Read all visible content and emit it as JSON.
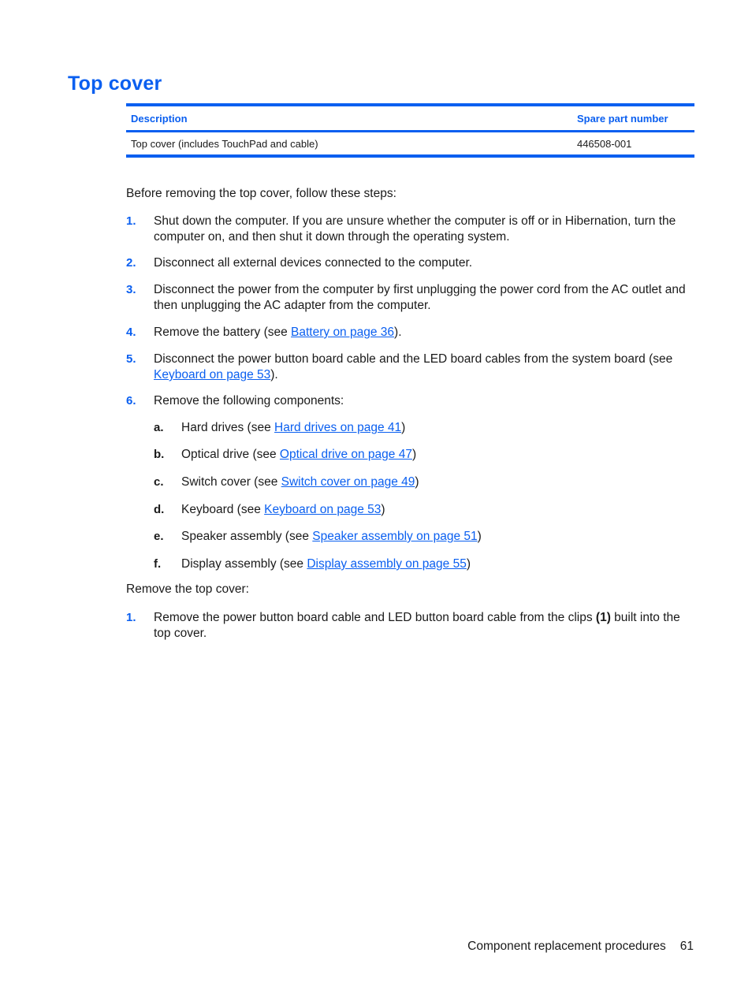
{
  "title": "Top cover",
  "table": {
    "headers": [
      "Description",
      "Spare part number"
    ],
    "rows": [
      {
        "description": "Top cover (includes TouchPad and cable)",
        "part_number": "446508-001"
      }
    ]
  },
  "intro": "Before removing the top cover, follow these steps:",
  "prep_steps": [
    {
      "num": "1.",
      "text": "Shut down the computer. If you are unsure whether the computer is off or in Hibernation, turn the computer on, and then shut it down through the operating system."
    },
    {
      "num": "2.",
      "text": "Disconnect all external devices connected to the computer."
    },
    {
      "num": "3.",
      "text": "Disconnect the power from the computer by first unplugging the power cord from the AC outlet and then unplugging the AC adapter from the computer."
    },
    {
      "num": "4.",
      "before": "Remove the battery (see ",
      "link": "Battery on page 36",
      "after": ")."
    },
    {
      "num": "5.",
      "before": "Disconnect the power button board cable and the LED board cables from the system board (see ",
      "link": "Keyboard on page 53",
      "after": ")."
    },
    {
      "num": "6.",
      "text": "Remove the following components:"
    }
  ],
  "components": [
    {
      "letter": "a.",
      "before": "Hard drives (see ",
      "link": "Hard drives on page 41",
      "after": ")"
    },
    {
      "letter": "b.",
      "before": "Optical drive (see ",
      "link": "Optical drive on page 47",
      "after": ")"
    },
    {
      "letter": "c.",
      "before": "Switch cover (see ",
      "link": "Switch cover on page 49",
      "after": ")"
    },
    {
      "letter": "d.",
      "before": "Keyboard (see ",
      "link": "Keyboard on page 53",
      "after": ")"
    },
    {
      "letter": "e.",
      "before": "Speaker assembly (see ",
      "link": "Speaker assembly on page 51",
      "after": ")"
    },
    {
      "letter": "f.",
      "before": "Display assembly (see ",
      "link": "Display assembly on page 55",
      "after": ")"
    }
  ],
  "remove_intro": "Remove the top cover:",
  "remove_steps": [
    {
      "num": "1.",
      "before": "Remove the power button board cable and LED button board cable from the clips ",
      "bold": "(1)",
      "after": " built into the top cover."
    }
  ],
  "footer": {
    "section": "Component replacement procedures",
    "page": "61"
  },
  "colors": {
    "accent": "#0a5ff0",
    "text": "#1a1a1a"
  }
}
